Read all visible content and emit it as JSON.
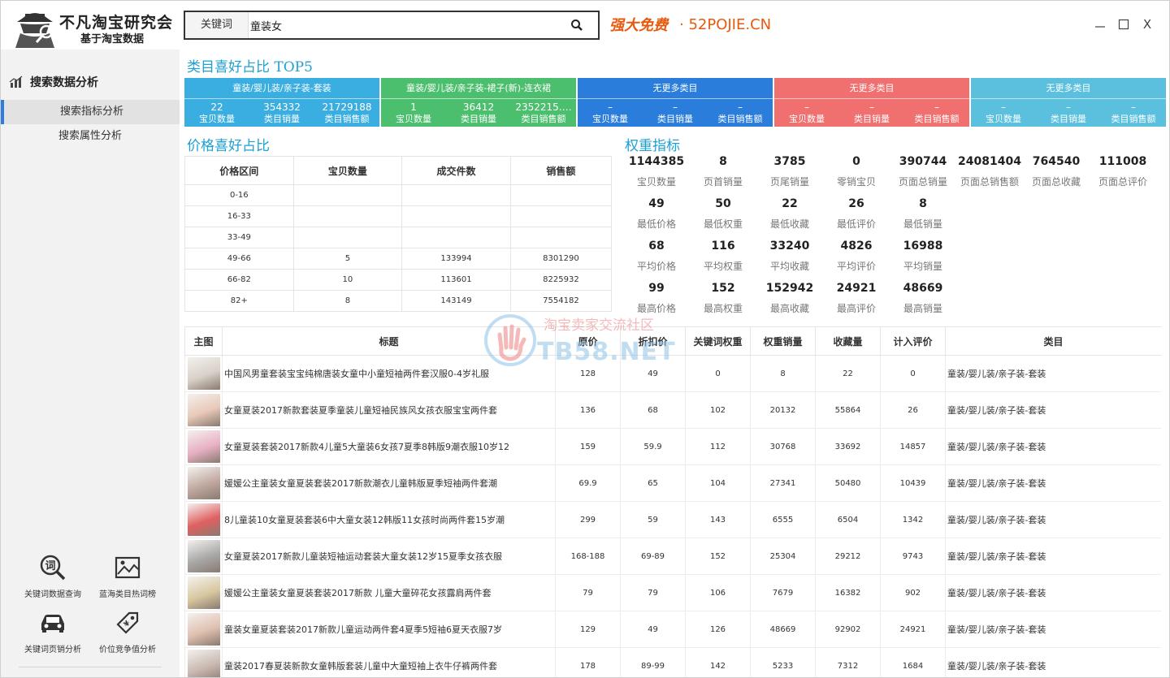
{
  "app": {
    "logo_title": "不凡淘宝研究会",
    "logo_subtitle": "基于淘宝数据",
    "promo_text": "强大免费",
    "promo_domain": "· 52POJIE.CN",
    "close_glyph": "X"
  },
  "search": {
    "label": "关键词",
    "value": "童装女"
  },
  "sidebar": {
    "section_title": "搜索数据分析",
    "items": [
      {
        "label": "搜索指标分析",
        "active": true
      },
      {
        "label": "搜索属性分析",
        "active": false
      }
    ],
    "tools": [
      {
        "label": "关键词数据查询",
        "icon": "keyword-search-icon"
      },
      {
        "label": "蓝海类目热词榜",
        "icon": "image-chart-icon"
      },
      {
        "label": "关键词页销分析",
        "icon": "car-icon"
      },
      {
        "label": "价位竞争值分析",
        "icon": "price-tag-icon"
      }
    ]
  },
  "top5": {
    "title": "类目喜好占比 TOP5",
    "categories": [
      {
        "name": "童装/婴儿装/亲子装-套装",
        "color": "#3aaee0",
        "count": "22",
        "sales": "354332",
        "amount": "21729188"
      },
      {
        "name": "童装/婴儿装/亲子装-裙子(新)-连衣裙",
        "color": "#4cbf6e",
        "count": "1",
        "sales": "36412",
        "amount": "2352215.…"
      },
      {
        "name": "无更多类目",
        "color": "#2a7ddb",
        "count": "–",
        "sales": "–",
        "amount": "–"
      },
      {
        "name": "无更多类目",
        "color": "#f07070",
        "count": "–",
        "sales": "–",
        "amount": "–"
      },
      {
        "name": "无更多类目",
        "color": "#5bc0de",
        "count": "–",
        "sales": "–",
        "amount": "–"
      }
    ],
    "labels": {
      "count": "宝贝数量",
      "sales": "类目销量",
      "amount": "类目销售额"
    }
  },
  "price": {
    "title": "价格喜好占比",
    "headers": [
      "价格区间",
      "宝贝数量",
      "成交件数",
      "销售额"
    ],
    "rows": [
      [
        "0-16",
        "",
        "",
        ""
      ],
      [
        "16-33",
        "",
        "",
        ""
      ],
      [
        "33-49",
        "",
        "",
        ""
      ],
      [
        "49-66",
        "5",
        "133994",
        "8301290"
      ],
      [
        "66-82",
        "10",
        "113601",
        "8225932"
      ],
      [
        "82+",
        "8",
        "143149",
        "7554182"
      ]
    ]
  },
  "weights": {
    "title": "权重指标",
    "rows": [
      [
        {
          "value": "1144385",
          "label": "宝贝数量"
        },
        {
          "value": "8",
          "label": "页首销量"
        },
        {
          "value": "3785",
          "label": "页尾销量"
        },
        {
          "value": "0",
          "label": "零销宝贝"
        },
        {
          "value": "390744",
          "label": "页面总销量"
        },
        {
          "value": "24081404",
          "label": "页面总销售额"
        },
        {
          "value": "764540",
          "label": "页面总收藏"
        },
        {
          "value": "111008",
          "label": "页面总评价"
        }
      ],
      [
        {
          "value": "49",
          "label": "最低价格"
        },
        {
          "value": "50",
          "label": "最低权重"
        },
        {
          "value": "22",
          "label": "最低收藏"
        },
        {
          "value": "26",
          "label": "最低评价"
        },
        {
          "value": "8",
          "label": "最低销量"
        }
      ],
      [
        {
          "value": "68",
          "label": "平均价格"
        },
        {
          "value": "116",
          "label": "平均权重"
        },
        {
          "value": "33240",
          "label": "平均收藏"
        },
        {
          "value": "4826",
          "label": "平均评价"
        },
        {
          "value": "16988",
          "label": "平均销量"
        }
      ],
      [
        {
          "value": "99",
          "label": "最高价格"
        },
        {
          "value": "152",
          "label": "最高权重"
        },
        {
          "value": "152942",
          "label": "最高收藏"
        },
        {
          "value": "24921",
          "label": "最高评价"
        },
        {
          "value": "48669",
          "label": "最高销量"
        }
      ]
    ]
  },
  "products": {
    "headers": [
      "主图",
      "标题",
      "原价",
      "折扣价",
      "关键词权重",
      "权重销量",
      "收藏量",
      "计入评价",
      "类目"
    ],
    "rows": [
      {
        "title": "中国风男童套装宝宝纯棉唐装女童中小童短袖两件套汉服0-4岁礼服",
        "price": "128",
        "discount": "49",
        "kw_weight": "0",
        "weight_sales": "8",
        "fav": "22",
        "reviews": "0",
        "category": "童装/婴儿装/亲子装-套装",
        "thumb": "#d8d0c8"
      },
      {
        "title": "女童夏装2017新款套装夏季童装儿童短袖民族风女孩衣服宝宝两件套",
        "price": "136",
        "discount": "68",
        "kw_weight": "102",
        "weight_sales": "20132",
        "fav": "55864",
        "reviews": "26",
        "category": "童装/婴儿装/亲子装-套装",
        "thumb": "#e8c8b8"
      },
      {
        "title": "女童夏装套装2017新款4儿童5大童装6女孩7夏季8韩版9潮衣服10岁12",
        "price": "159",
        "discount": "59.9",
        "kw_weight": "112",
        "weight_sales": "30768",
        "fav": "33692",
        "reviews": "14857",
        "category": "童装/婴儿装/亲子装-套装",
        "thumb": "#e8b0c4"
      },
      {
        "title": "媛媛公主童装女童夏装套装2017新款潮衣儿童韩版夏季短袖两件套潮",
        "price": "69.9",
        "discount": "65",
        "kw_weight": "104",
        "weight_sales": "27341",
        "fav": "50480",
        "reviews": "10439",
        "category": "童装/婴儿装/亲子装-套装",
        "thumb": "#c0a8a0"
      },
      {
        "title": "8儿童装10女童夏装套装6中大童女装12韩版11女孩时尚两件套15岁潮",
        "price": "299",
        "discount": "59",
        "kw_weight": "143",
        "weight_sales": "6555",
        "fav": "6504",
        "reviews": "1342",
        "category": "童装/婴儿装/亲子装-套装",
        "thumb": "#e06060"
      },
      {
        "title": "女童夏装2017新款儿童装短袖运动套装大童女装12岁15夏季女孩衣服",
        "price": "168-188",
        "discount": "69-89",
        "kw_weight": "152",
        "weight_sales": "25304",
        "fav": "29212",
        "reviews": "9743",
        "category": "童装/婴儿装/亲子装-套装",
        "thumb": "#a8a8a8"
      },
      {
        "title": "媛媛公主童装女童夏装套装2017新款 儿童大童碎花女孩露肩两件套",
        "price": "79",
        "discount": "79",
        "kw_weight": "106",
        "weight_sales": "7679",
        "fav": "16382",
        "reviews": "902",
        "category": "童装/婴儿装/亲子装-套装",
        "thumb": "#d8c8a0"
      },
      {
        "title": "童装女童夏装套装2017新款儿童运动两件套4夏季5短袖6夏天衣服7岁",
        "price": "129",
        "discount": "49",
        "kw_weight": "126",
        "weight_sales": "48669",
        "fav": "92902",
        "reviews": "24921",
        "category": "童装/婴儿装/亲子装-套装",
        "thumb": "#e0c0b0"
      },
      {
        "title": "童装2017春夏装新款女童韩版套装儿童中大童短袖上衣牛仔裤两件套",
        "price": "178",
        "discount": "89-99",
        "kw_weight": "142",
        "weight_sales": "5233",
        "fav": "7312",
        "reviews": "1684",
        "category": "童装/婴儿装/亲子装-套装",
        "thumb": "#c8b8b0"
      }
    ]
  },
  "watermark": {
    "line1": "淘宝卖家交流社区",
    "line2": "TB58.NET"
  }
}
